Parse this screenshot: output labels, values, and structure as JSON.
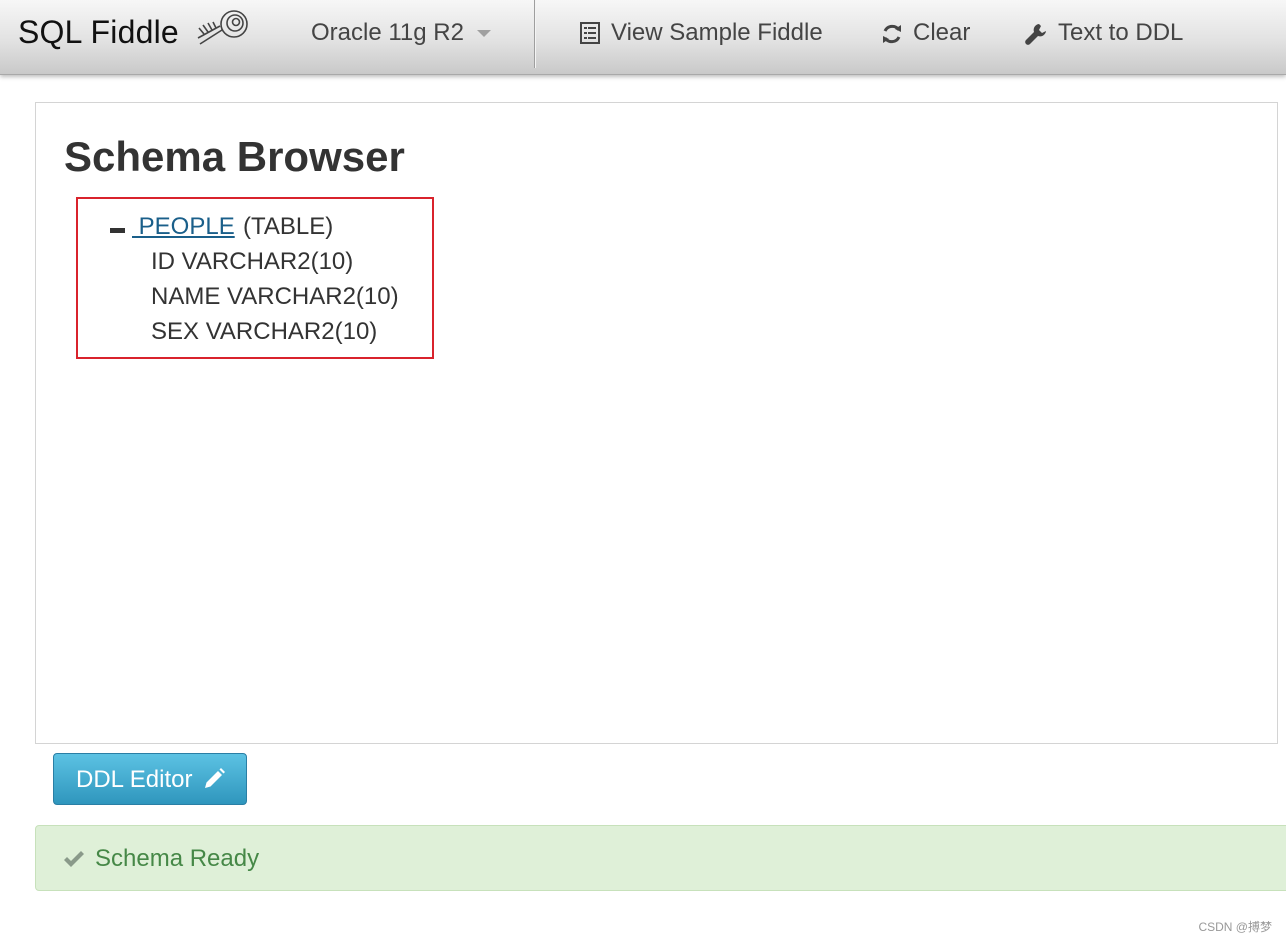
{
  "navbar": {
    "brand": "SQL Fiddle",
    "database_select": "Oracle 11g R2",
    "items": [
      {
        "label": "View Sample Fiddle",
        "icon": "list-icon"
      },
      {
        "label": "Clear",
        "icon": "refresh-icon"
      },
      {
        "label": "Text to DDL",
        "icon": "wrench-icon"
      }
    ]
  },
  "schema_browser": {
    "title": "Schema Browser",
    "tables": [
      {
        "name": " PEOPLE",
        "type": "(TABLE)",
        "columns": [
          "ID VARCHAR2(10)",
          "NAME VARCHAR2(10)",
          "SEX VARCHAR2(10)"
        ]
      }
    ]
  },
  "ddl_button": {
    "label": "DDL Editor",
    "icon": "pencil-icon"
  },
  "status": {
    "message": "Schema Ready",
    "icon": "check-icon",
    "color": "#468847"
  },
  "watermark": "CSDN @搏梦"
}
